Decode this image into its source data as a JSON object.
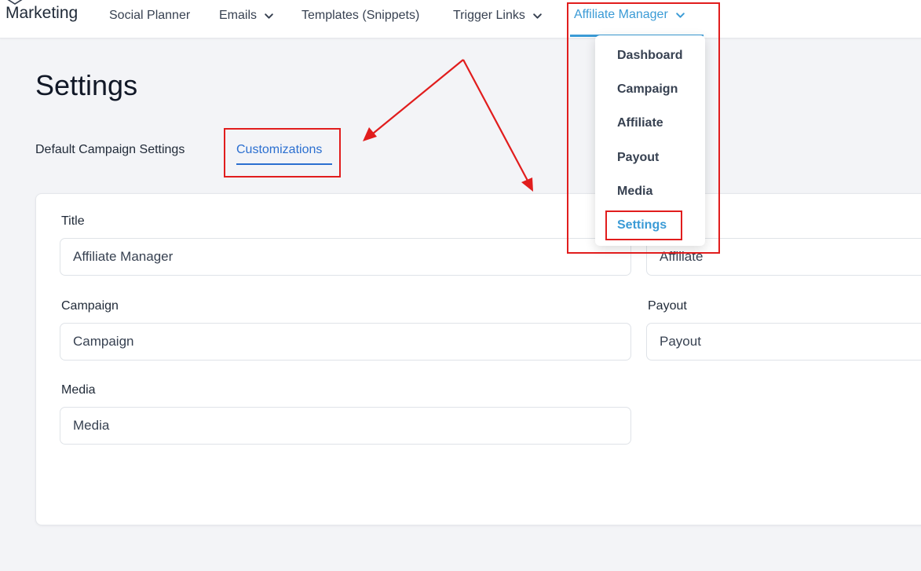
{
  "header": {
    "brand": "Marketing",
    "nav": [
      {
        "label": "Social Planner",
        "has_dropdown": false
      },
      {
        "label": "Emails",
        "has_dropdown": true
      },
      {
        "label": "Templates (Snippets)",
        "has_dropdown": false
      },
      {
        "label": "Trigger Links",
        "has_dropdown": true
      },
      {
        "label": "Affiliate Manager",
        "has_dropdown": true,
        "active": true
      }
    ]
  },
  "dropdown": {
    "items": [
      {
        "label": "Dashboard"
      },
      {
        "label": "Campaign"
      },
      {
        "label": "Affiliate"
      },
      {
        "label": "Payout"
      },
      {
        "label": "Media"
      },
      {
        "label": "Settings",
        "selected": true
      }
    ]
  },
  "page": {
    "title": "Settings",
    "tabs": [
      {
        "label": "Default Campaign Settings",
        "active": false
      },
      {
        "label": "Customizations",
        "active": true
      }
    ]
  },
  "form": {
    "title": {
      "label": "Title",
      "value": "Affiliate Manager"
    },
    "affiliate": {
      "value": "Affiliate"
    },
    "campaign": {
      "label": "Campaign",
      "value": "Campaign"
    },
    "payout": {
      "label": "Payout",
      "value": "Payout"
    },
    "media": {
      "label": "Media",
      "value": "Media"
    }
  },
  "colors": {
    "accent": "#3b9bd6",
    "tab_active": "#2b6fd0",
    "annotation": "#e11d1d",
    "background": "#f3f4f7"
  },
  "icons": {
    "brand": "brand-logo-icon",
    "dropdown": "chevron-down-icon"
  }
}
